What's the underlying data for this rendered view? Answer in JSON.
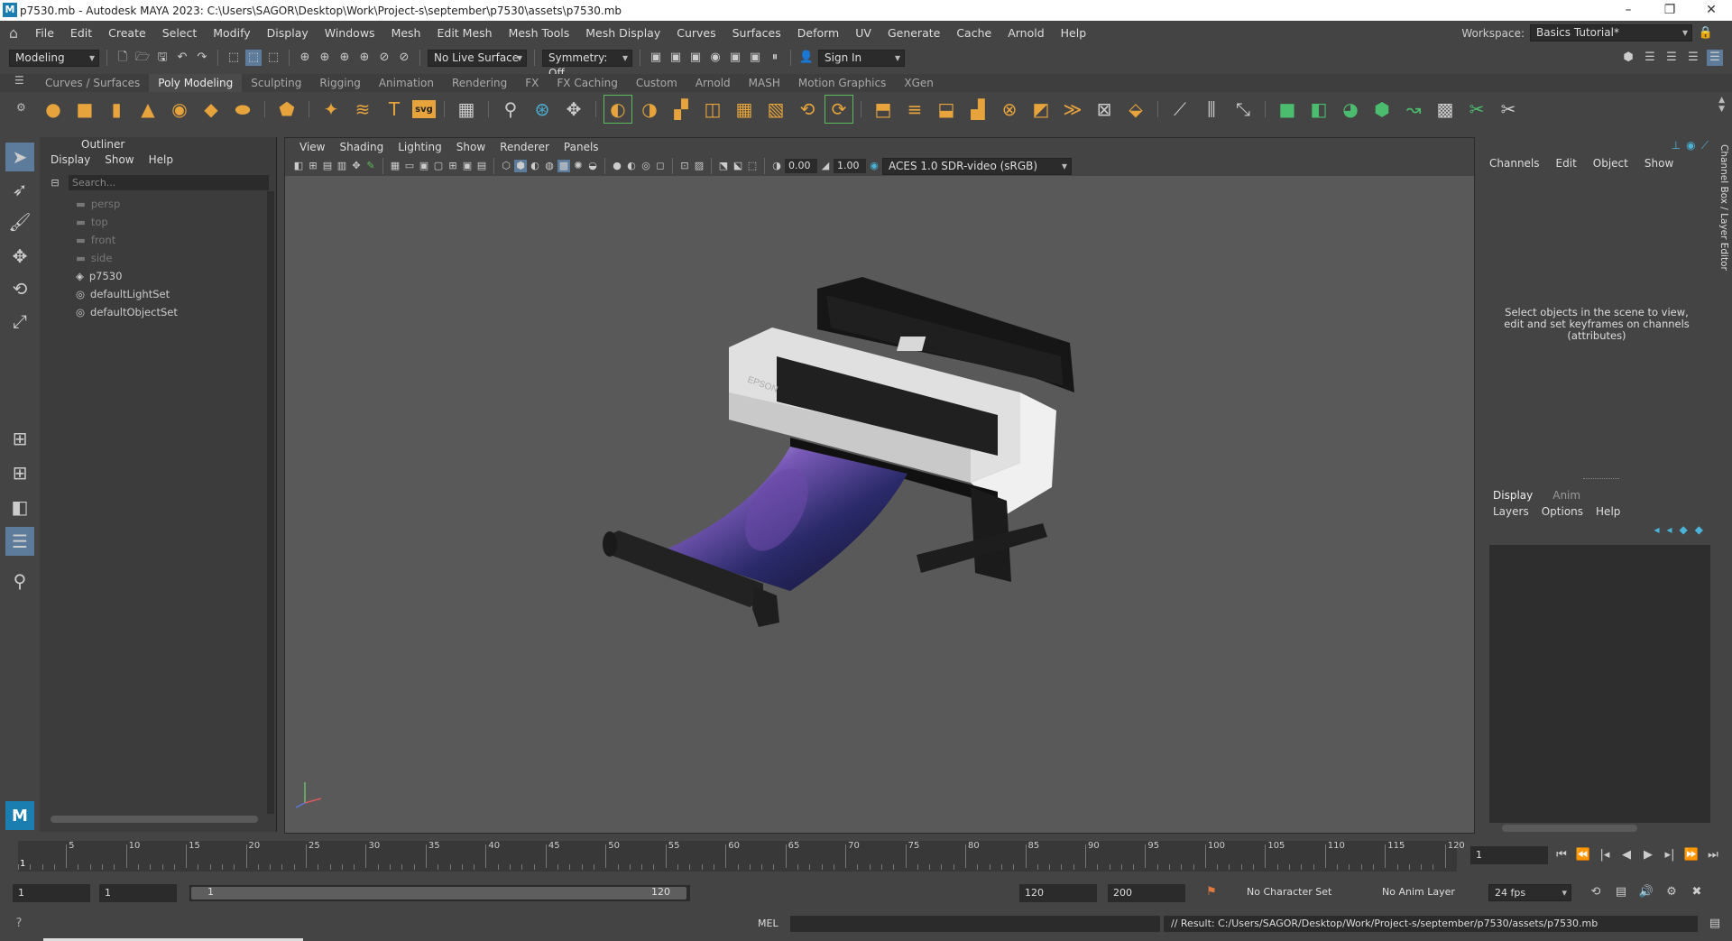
{
  "window": {
    "title": "p7530.mb - Autodesk MAYA 2023: C:\\Users\\SAGOR\\Desktop\\Work\\Project-s\\september\\p7530\\assets\\p7530.mb",
    "app_icon": "M"
  },
  "menubar": {
    "items": [
      "File",
      "Edit",
      "Create",
      "Select",
      "Modify",
      "Display",
      "Windows",
      "Mesh",
      "Edit Mesh",
      "Mesh Tools",
      "Mesh Display",
      "Curves",
      "Surfaces",
      "Deform",
      "UV",
      "Generate",
      "Cache",
      "Arnold",
      "Help"
    ],
    "workspace_label": "Workspace:",
    "workspace_value": "Basics Tutorial*"
  },
  "statusline": {
    "mode": "Modeling",
    "live_surface": "No Live Surface",
    "symmetry": "Symmetry: Off",
    "sign_in": "Sign In"
  },
  "shelf": {
    "tabs": [
      "Curves / Surfaces",
      "Poly Modeling",
      "Sculpting",
      "Rigging",
      "Animation",
      "Rendering",
      "FX",
      "FX Caching",
      "Custom",
      "Arnold",
      "MASH",
      "Motion Graphics",
      "XGen"
    ],
    "active_tab": "Poly Modeling",
    "svg_label": "svg"
  },
  "outliner": {
    "title": "Outliner",
    "menu": [
      "Display",
      "Show",
      "Help"
    ],
    "search_placeholder": "Search...",
    "items": [
      {
        "label": "persp",
        "type": "camera",
        "dim": true
      },
      {
        "label": "top",
        "type": "camera",
        "dim": true
      },
      {
        "label": "front",
        "type": "camera",
        "dim": true
      },
      {
        "label": "side",
        "type": "camera",
        "dim": true
      },
      {
        "label": "p7530",
        "type": "transform",
        "dim": false
      },
      {
        "label": "defaultLightSet",
        "type": "set",
        "dim": false
      },
      {
        "label": "defaultObjectSet",
        "type": "set",
        "dim": false
      }
    ]
  },
  "viewport": {
    "menu": [
      "View",
      "Shading",
      "Lighting",
      "Show",
      "Renderer",
      "Panels"
    ],
    "exposure": "0.00",
    "gamma": "1.00",
    "color_space": "ACES 1.0 SDR-video (sRGB)",
    "model_brand": "EPSON"
  },
  "channelbox": {
    "menu": [
      "Channels",
      "Edit",
      "Object",
      "Show"
    ],
    "message": "Select objects in the scene to view, edit and set keyframes on channels (attributes)",
    "side_label": "Channel Box / Layer Editor"
  },
  "layereditor": {
    "tabs": [
      "Display",
      "Anim"
    ],
    "menu": [
      "Layers",
      "Options",
      "Help"
    ]
  },
  "timeslider": {
    "ticks": [
      "5",
      "10",
      "15",
      "20",
      "25",
      "30",
      "35",
      "40",
      "45",
      "50",
      "55",
      "60",
      "65",
      "70",
      "75",
      "80",
      "85",
      "90",
      "95",
      "100",
      "105",
      "110",
      "115",
      "120"
    ],
    "current_frame_marker": "1",
    "current_frame": "1"
  },
  "range": {
    "start": "1",
    "playback_start": "1",
    "range_start": "1",
    "range_end": "120",
    "playback_end": "120",
    "end": "200",
    "character_set": "No Character Set",
    "anim_layer": "No Anim Layer",
    "fps": "24 fps"
  },
  "cmdline": {
    "lang": "MEL",
    "result": "// Result: C:/Users/SAGOR/Desktop/Work/Project-s/september/p7530/assets/p7530.mb"
  },
  "toolbox": {
    "logo": "M"
  }
}
